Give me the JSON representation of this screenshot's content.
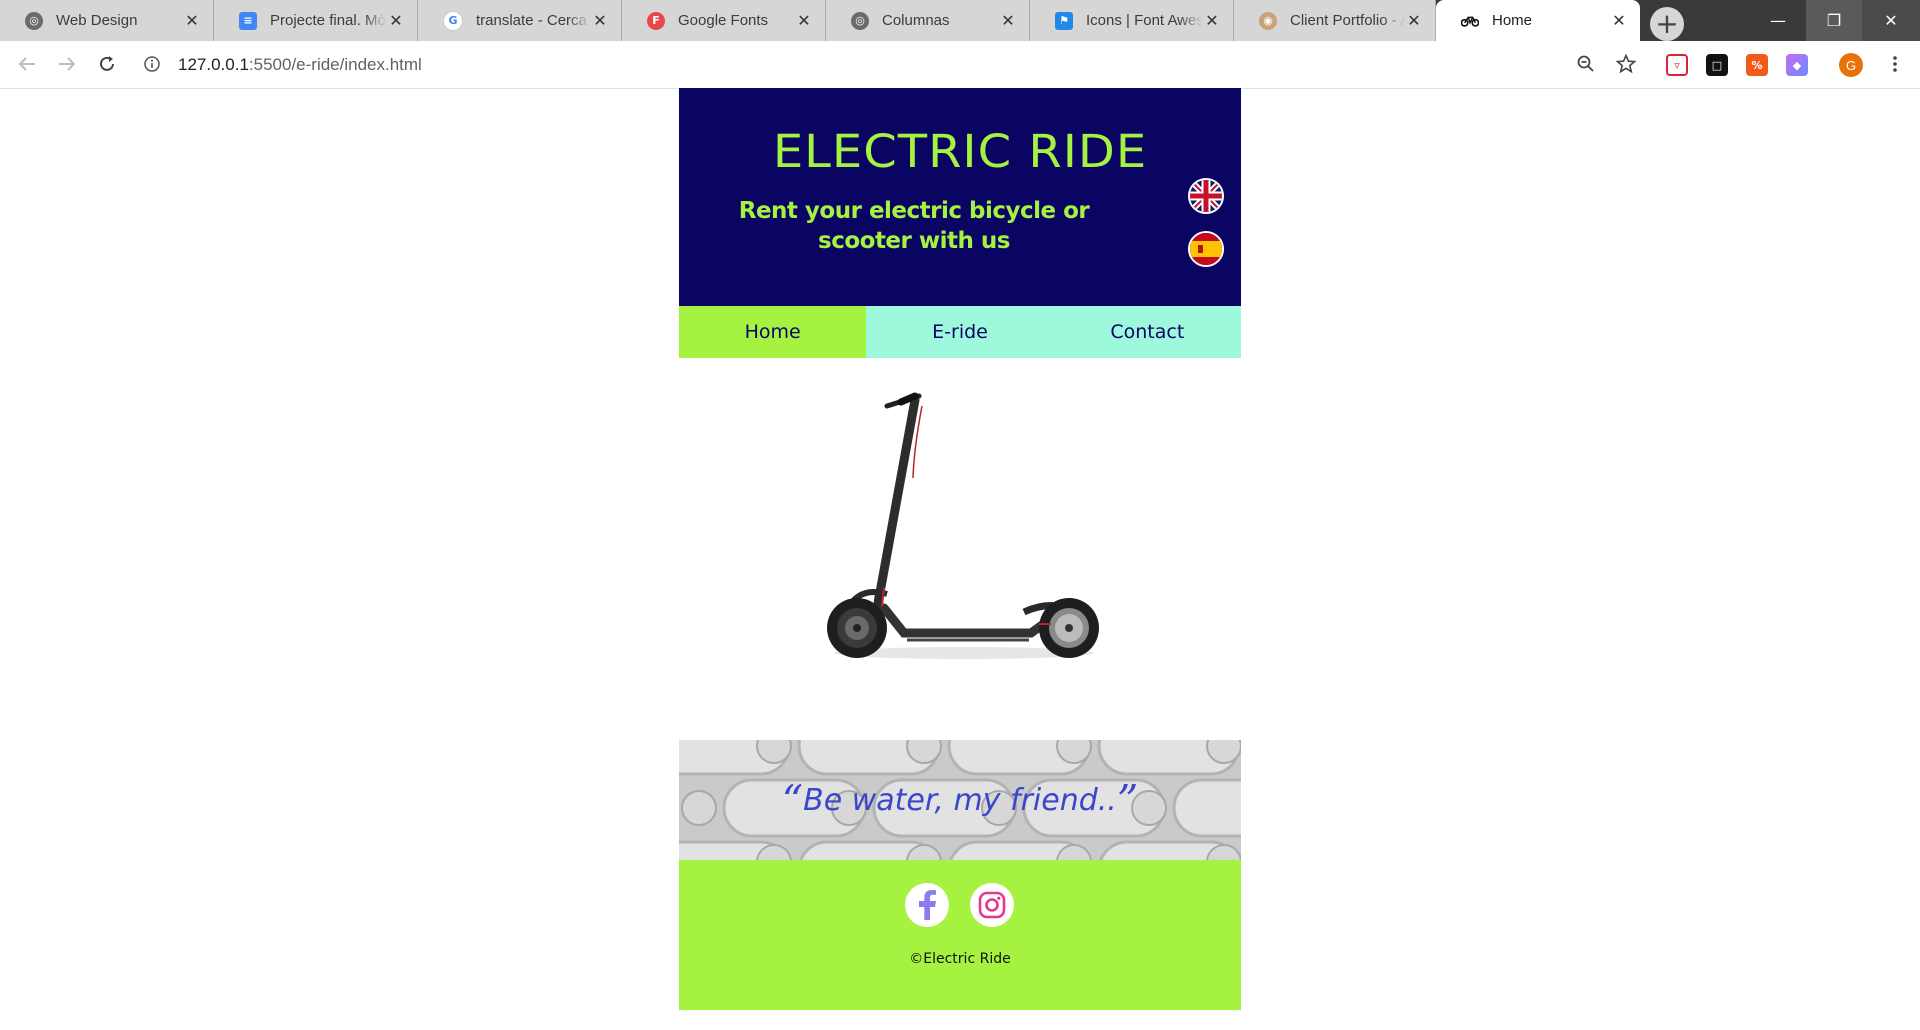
{
  "browser": {
    "tabs": [
      {
        "title": "Web Design",
        "favicon": "globe-icon",
        "active": false
      },
      {
        "title": "Projecte final. Mòdul",
        "favicon": "docs-icon",
        "active": false
      },
      {
        "title": "translate - Cerca amb Google",
        "favicon": "google-icon",
        "active": false
      },
      {
        "title": "Google Fonts",
        "favicon": "google-fonts-icon",
        "active": false
      },
      {
        "title": "Columnas",
        "favicon": "globe-icon",
        "active": false
      },
      {
        "title": "Icons | Font Awesome",
        "favicon": "font-awesome-flag-icon",
        "active": false
      },
      {
        "title": "Client Portfolio - Art",
        "favicon": "palette-icon",
        "active": false
      },
      {
        "title": "Home",
        "favicon": "bicycle-icon",
        "active": true
      }
    ],
    "address": {
      "host": "127.0.0.1",
      "path": ":5500/e-ride/index.html"
    },
    "profile_initial": "G"
  },
  "site": {
    "title": "ELECTRIC RIDE",
    "subtitle": "Rent your electric bicycle or scooter with us",
    "nav": [
      {
        "label": "Home",
        "active": true
      },
      {
        "label": "E-ride",
        "active": false
      },
      {
        "label": "Contact",
        "active": false
      }
    ],
    "quote": "Be water, my friend..",
    "copyright": "©Electric Ride",
    "colors": {
      "header_bg": "#0a0563",
      "accent_green": "#a6f241",
      "nav_mint": "#9ef8dc",
      "quote_text": "#3a47c8"
    }
  }
}
